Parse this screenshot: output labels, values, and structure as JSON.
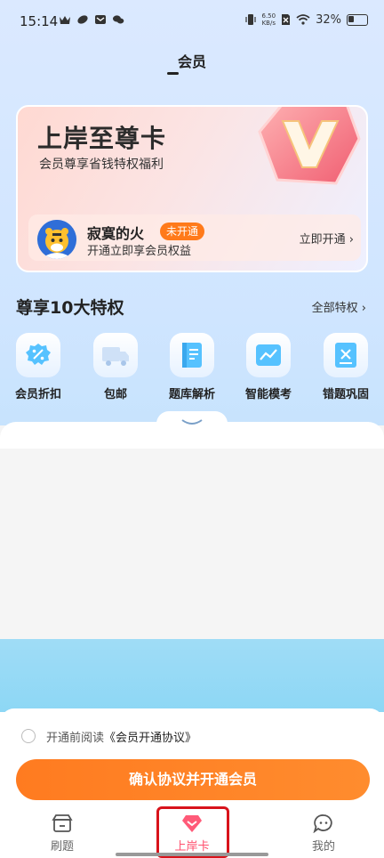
{
  "status_bar": {
    "time": "15:14",
    "net_speed_value": "6.50",
    "net_speed_unit": "KB/s",
    "battery": "32%"
  },
  "header": {
    "title": "会员"
  },
  "vip_card": {
    "title": "上岸至尊卡",
    "subtitle": "会员尊享省钱特权福利",
    "user": {
      "name": "寂寞的火",
      "badge": "未开通",
      "hint": "开通立即享会员权益",
      "action": "立即开通"
    }
  },
  "privileges": {
    "title": "尊享10大特权",
    "all_link": "全部特权",
    "items": [
      {
        "label": "会员折扣",
        "icon": "discount-icon"
      },
      {
        "label": "包邮",
        "icon": "truck-icon"
      },
      {
        "label": "题库解析",
        "icon": "book-icon"
      },
      {
        "label": "智能模考",
        "icon": "chart-icon"
      },
      {
        "label": "错题巩固",
        "icon": "wrong-question-icon"
      }
    ]
  },
  "agreement": {
    "prefix": "开通前阅读",
    "link": "《会员开通协议》"
  },
  "cta": {
    "label": "确认协议并开通会员"
  },
  "tabbar": {
    "items": [
      {
        "label": "刷题",
        "icon": "store-icon"
      },
      {
        "label": "上岸卡",
        "icon": "diamond-icon"
      },
      {
        "label": "我的",
        "icon": "chat-bubble-icon"
      }
    ]
  },
  "colors": {
    "accent": "#ff7b20",
    "active_tab": "#ff4f6d",
    "highlight": "#d8131b"
  }
}
